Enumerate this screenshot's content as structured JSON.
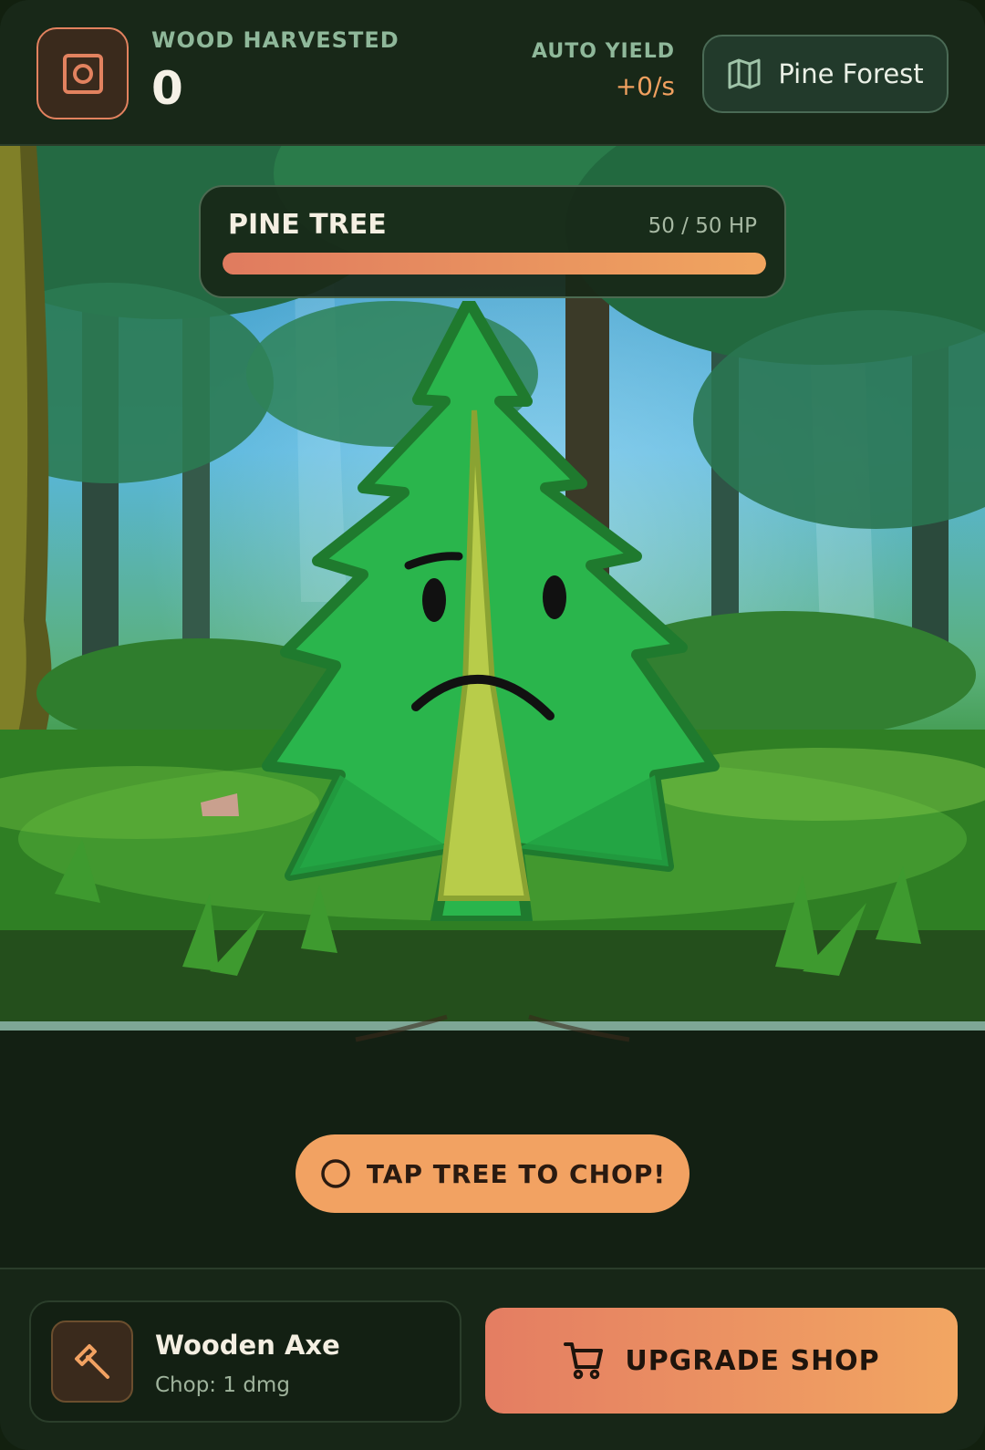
{
  "header": {
    "wood_label": "WOOD HARVESTED",
    "wood_count": "0",
    "yield_label": "AUTO YIELD",
    "yield_value": "+0/s",
    "location": "Pine Forest",
    "logo_icon": "target-square-icon",
    "map_icon": "map-icon"
  },
  "tree": {
    "name": "PINE TREE",
    "hp_text": "50 / 50 HP",
    "hp_fraction": 1.0,
    "character": "pine-tree-character"
  },
  "actions": {
    "chop_label": "TAP TREE TO CHOP!",
    "chop_icon": "circle-icon"
  },
  "tool": {
    "name": "Wooden Axe",
    "stat": "Chop: 1 dmg",
    "icon": "axe-icon"
  },
  "shop": {
    "label": "UPGRADE SHOP",
    "icon": "cart-icon"
  },
  "colors": {
    "accent_orange": "#f2a262",
    "accent_coral": "#e47d62",
    "panel_dark": "#182818",
    "label_green": "#8fb89a"
  }
}
